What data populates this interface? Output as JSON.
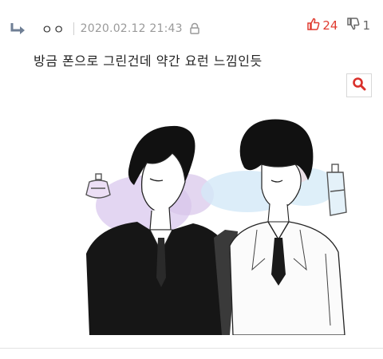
{
  "comment": {
    "username": "ㅇㅇ",
    "timestamp": "2020.02.12 21:43",
    "text": "방금 폰으로 그린건데 약간 요런 느낌인듯",
    "upvotes": "24",
    "downvotes": "1"
  },
  "icons": {
    "reply": "reply-arrow-icon",
    "lock": "lock-icon",
    "thumbs_up": "thumbs-up-icon",
    "thumbs_down": "thumbs-down-icon",
    "zoom": "search-icon"
  },
  "colors": {
    "upvote": "#e03c31",
    "zoom_accent": "#d9302b",
    "meta_gray": "#9a9a9a"
  }
}
